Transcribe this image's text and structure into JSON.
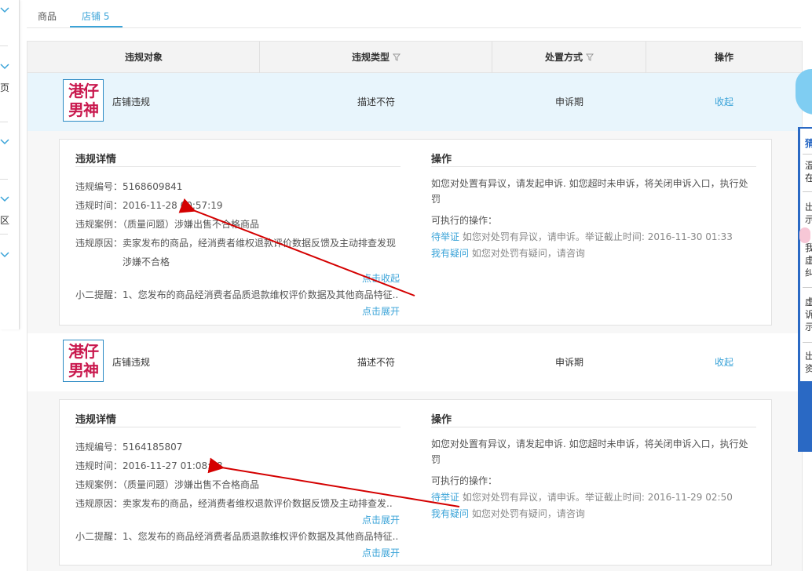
{
  "sidebar": {
    "fragments": [
      "页",
      "区"
    ]
  },
  "tabs": [
    {
      "label": "商品"
    },
    {
      "label": "店铺 5"
    }
  ],
  "table": {
    "headers": {
      "target": "违规对象",
      "violation_type": "违规类型",
      "method": "处置方式",
      "operation": "操作"
    }
  },
  "records": [
    {
      "logo_text": "港仔男神",
      "type": "店铺违规",
      "violation_type": "描述不符",
      "method": "申诉期",
      "toggle": "收起",
      "detail": {
        "title": "违规详情",
        "id_label": "违规编号：",
        "id": "5168609841",
        "time_label": "违规时间：",
        "time": "2016-11-28 00:57:19",
        "case_label": "违规案例：",
        "case": "（质量问题）涉嫌出售不合格商品",
        "reason_label": "违规原因：",
        "reason_line1": "卖家发布的商品，经消费者维权退款评价数据反馈及主动排查发现",
        "reason_line2": "涉嫌不合格",
        "reason_toggle": "点击收起",
        "reminder": "小二提醒：1、您发布的商品经消费者品质退款维权评价数据及其他商品特征..",
        "reminder_toggle": "点击展开"
      },
      "ops": {
        "title": "操作",
        "desc_line1": "如您对处置有异议，请发起申诉. 如您超时未申诉，将关闭申诉入口，执行处",
        "desc_line2": "罚",
        "available_label": "可执行的操作：",
        "action1": "待举证",
        "action1_desc": "如您对处罚有异议，请申诉。举证截止时间: 2016-11-30 01:33",
        "action2": "我有疑问",
        "action2_desc": "如您对处罚有疑问，请咨询"
      }
    },
    {
      "logo_text": "港仔男神",
      "type": "店铺违规",
      "violation_type": "描述不符",
      "method": "申诉期",
      "toggle": "收起",
      "detail": {
        "title": "违规详情",
        "id_label": "违规编号：",
        "id": "5164185807",
        "time_label": "违规时间：",
        "time": "2016-11-27 01:08:48",
        "case_label": "违规案例：",
        "case": "（质量问题）涉嫌出售不合格商品",
        "reason_label": "违规原因：",
        "reason_line1": "卖家发布的商品，经消费者维权退款评价数据反馈及主动排查发..",
        "reason_toggle": "点击展开",
        "reminder": "小二提醒：1、您发布的商品经消费者品质退款维权评价数据及其他商品特征..",
        "reminder_toggle": "点击展开"
      },
      "ops": {
        "title": "操作",
        "desc_line1": "如您对处置有异议，请发起申诉. 如您超时未申诉，将关闭申诉入口，执行处",
        "desc_line2": "罚",
        "available_label": "可执行的操作：",
        "action1": "待举证",
        "action1_desc": "如您对处罚有异议，请申诉。举证截止时间: 2016-11-29 02:50",
        "action2": "我有疑问",
        "action2_desc": "如您对处罚有疑问，请咨询"
      }
    }
  ],
  "right_panel": {
    "chars": [
      "猜",
      "温",
      "在",
      "出",
      "示",
      "我",
      "虚",
      "纠",
      "虚",
      "诉",
      "示",
      "出",
      "资"
    ]
  },
  "colors": {
    "accent": "#3aa3d8",
    "row_highlight": "#e8f5fc",
    "annotation_arrow": "#d40000",
    "logo_text": "#c9194e"
  }
}
